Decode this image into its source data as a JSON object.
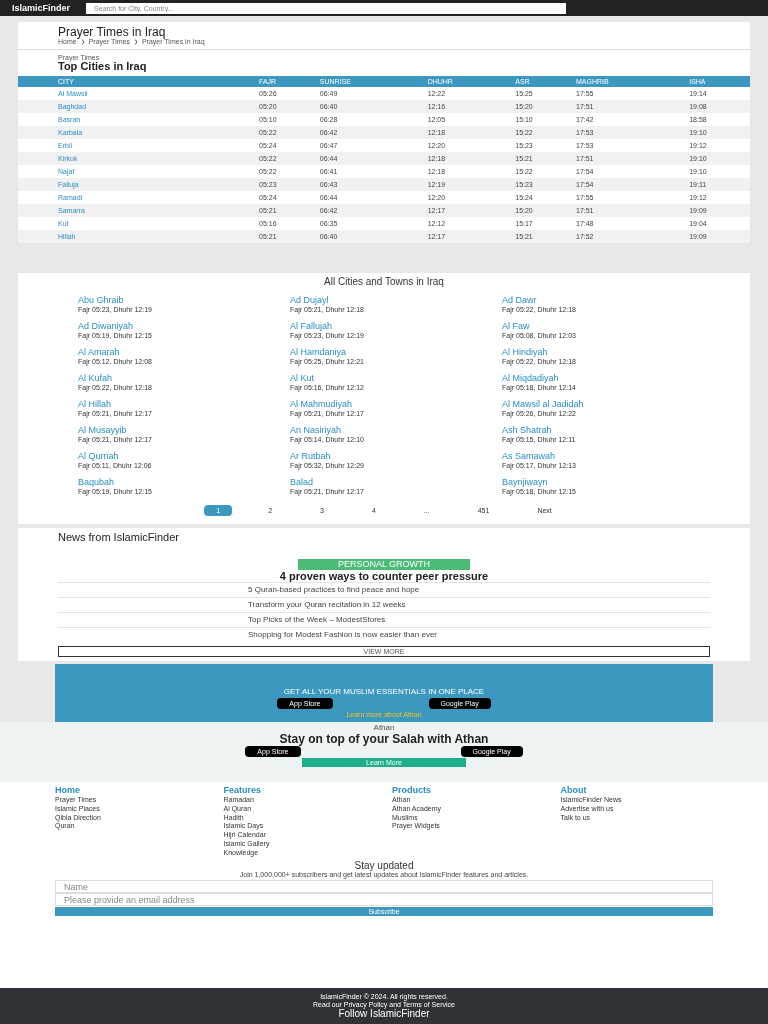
{
  "header": {
    "logo": "IslamicFinder",
    "search": {
      "placeholder": "Search for City, Country..."
    }
  },
  "page": {
    "title": "Prayer Times in Iraq",
    "breadcrumbs": [
      "Home",
      "Prayer Times",
      "Prayer Times in Iraq"
    ]
  },
  "top_cities": {
    "subtitle": "Prayer Times",
    "title": "Top Cities in Iraq",
    "columns": [
      "CITY",
      "FAJR",
      "SUNRISE",
      "DHUHR",
      "ASR",
      "MAGHRIB",
      "ISHA"
    ],
    "rows": [
      [
        "Al Mawsil",
        "05:26",
        "06:49",
        "12:22",
        "15:25",
        "17:55",
        "19:14"
      ],
      [
        "Baghdad",
        "05:20",
        "06:40",
        "12:16",
        "15:20",
        "17:51",
        "19:08"
      ],
      [
        "Basrah",
        "05:10",
        "06:28",
        "12:05",
        "15:10",
        "17:42",
        "18:58"
      ],
      [
        "Karbala",
        "05:22",
        "06:42",
        "12:18",
        "15:22",
        "17:53",
        "19:10"
      ],
      [
        "Erbil",
        "05:24",
        "06:47",
        "12:20",
        "15:23",
        "17:53",
        "19:12"
      ],
      [
        "Kirkuk",
        "05:22",
        "06:44",
        "12:18",
        "15:21",
        "17:51",
        "19:10"
      ],
      [
        "Najaf",
        "05:22",
        "06:41",
        "12:18",
        "15:22",
        "17:54",
        "19:10"
      ],
      [
        "Falluja",
        "05:23",
        "06:43",
        "12:19",
        "15:23",
        "17:54",
        "19:11"
      ],
      [
        "Ramadi",
        "05:24",
        "06:44",
        "12:20",
        "15:24",
        "17:55",
        "19:12"
      ],
      [
        "Samarra",
        "05:21",
        "06:42",
        "12:17",
        "15:20",
        "17:51",
        "19:09"
      ],
      [
        "Kut",
        "05:16",
        "06:35",
        "12:12",
        "15:17",
        "17:48",
        "19:04"
      ],
      [
        "Hillah",
        "05:21",
        "06:40",
        "12:17",
        "15:21",
        "17:52",
        "19:09"
      ]
    ]
  },
  "all_cities": {
    "title": "All Cities and Towns in Iraq",
    "columns": [
      [
        {
          "name": "Abu Ghraib",
          "info": "Fajr 05:23, Dhuhr 12:19"
        },
        {
          "name": "Ad Diwaniyah",
          "info": "Fajr 05:19, Dhuhr 12:15"
        },
        {
          "name": "Al Amarah",
          "info": "Fajr 05:12, Dhuhr 12:08"
        },
        {
          "name": "Al Kufah",
          "info": "Fajr 05:22, Dhuhr 12:18"
        },
        {
          "name": "Al Hillah",
          "info": "Fajr 05:21, Dhuhr 12:17"
        },
        {
          "name": "Al Musayyib",
          "info": "Fajr 05:21, Dhuhr 12:17"
        },
        {
          "name": "Al Qurnah",
          "info": "Fajr 05:11, Dhuhr 12:06"
        },
        {
          "name": "Baqubah",
          "info": "Fajr 05:19, Dhuhr 12:15"
        }
      ],
      [
        {
          "name": "Ad Dujayl",
          "info": "Fajr 05:21, Dhuhr 12:18"
        },
        {
          "name": "Al Fallujah",
          "info": "Fajr 05:23, Dhuhr 12:19"
        },
        {
          "name": "Al Hamdaniya",
          "info": "Fajr 05:25, Dhuhr 12:21"
        },
        {
          "name": "Al Kut",
          "info": "Fajr 05:16, Dhuhr 12:12"
        },
        {
          "name": "Al Mahmudiyah",
          "info": "Fajr 05:21, Dhuhr 12:17"
        },
        {
          "name": "An Nasiriyah",
          "info": "Fajr 05:14, Dhuhr 12:10"
        },
        {
          "name": "Ar Rutbah",
          "info": "Fajr 05:32, Dhuhr 12:29"
        },
        {
          "name": "Balad",
          "info": "Fajr 05:21, Dhuhr 12:17"
        }
      ],
      [
        {
          "name": "Ad Dawr",
          "info": "Fajr 05:22, Dhuhr 12:18"
        },
        {
          "name": "Al Faw",
          "info": "Fajr 05:08, Dhuhr 12:03"
        },
        {
          "name": "Al Hindiyah",
          "info": "Fajr 05:22, Dhuhr 12:18"
        },
        {
          "name": "Al Miqdadiyah",
          "info": "Fajr 05:18, Dhuhr 12:14"
        },
        {
          "name": "Al Mawsil al Jadidah",
          "info": "Fajr 05:26, Dhuhr 12:22"
        },
        {
          "name": "Ash Shatrah",
          "info": "Fajr 05:15, Dhuhr 12:11"
        },
        {
          "name": "As Samawah",
          "info": "Fajr 05:17, Dhuhr 12:13"
        },
        {
          "name": "Baynjiwayn",
          "info": "Fajr 05:18, Dhuhr 12:15"
        }
      ]
    ],
    "pages": [
      {
        "label": "1",
        "selected": true
      },
      {
        "label": "2",
        "selected": false
      },
      {
        "label": "3",
        "selected": false
      },
      {
        "label": "4",
        "selected": false
      },
      {
        "label": "...",
        "selected": false
      },
      {
        "label": "451",
        "selected": false
      },
      {
        "label": "Next",
        "selected": false
      }
    ]
  },
  "news": {
    "title": "News from IslamicFinder",
    "tag": "PERSONAL GROWTH",
    "headline": "4 proven ways to counter peer pressure",
    "items": [
      "5 Quran-based practices to find peace and hope",
      "Transform your Quran recitation in 12 weeks",
      "Top Picks of the Week – ModestStores",
      "Shopping for Modest Fashion is now easier than ever"
    ],
    "more": "VIEW MORE"
  },
  "essentials": {
    "title": "GET ALL YOUR MUSLIM ESSENTIALS IN ONE PLACE",
    "stores": [
      "App Store",
      "Google Play"
    ],
    "link": "Learn more about Athan"
  },
  "athan": {
    "name": "Athan",
    "headline": "Stay on top of your Salah with Athan",
    "stores": [
      "App Store",
      "Google Play"
    ],
    "button": "Learn More"
  },
  "footer": {
    "groups": [
      {
        "title": "Home",
        "links": [
          "Prayer Times",
          "Islamic Places",
          "Qibla Direction",
          "Quran"
        ]
      },
      {
        "title": "Features",
        "links": [
          "Ramadan",
          "Al Quran",
          "Hadith",
          "Islamic Days",
          "Hijri Calendar",
          "Islamic Gallery",
          "Knowledge"
        ]
      },
      {
        "title": "Products",
        "links": [
          "Athan",
          "Athan Academy",
          "Muslims",
          "Prayer Widgets"
        ]
      },
      {
        "title": "About",
        "links": [
          "IslamicFinder News",
          "Advertise with us",
          "Talk to us"
        ]
      }
    ],
    "newsletter": {
      "title": "Stay updated",
      "text": "Join 1,000,000+ subscribers and get latest updates about IslamicFinder features and articles.",
      "name_placeholder": "Name",
      "email_placeholder": "Please provide an email address",
      "button": "Subscribe"
    },
    "copyright": "IslamicFinder © 2024. All rights reserved.",
    "policy": "Read our Privacy Policy and Terms of Service",
    "follow": "Follow IslamicFinder"
  }
}
